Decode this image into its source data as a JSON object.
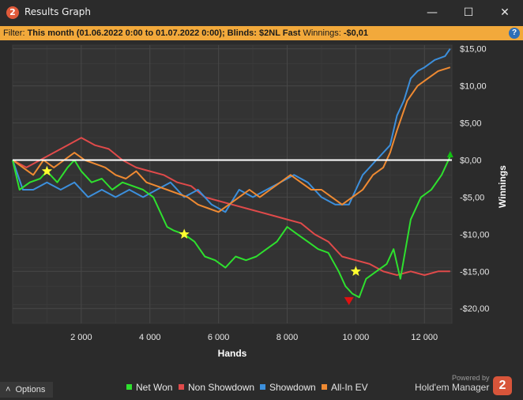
{
  "window": {
    "title": "Results Graph",
    "logo_glyph": "2",
    "minimize_glyph": "—",
    "maximize_glyph": "☐",
    "close_glyph": "✕"
  },
  "filter": {
    "label": "Filter:",
    "value": "This month (01.06.2022 0:00 to 01.07.2022 0:00); Blinds: $2NL Fast",
    "winnings_label": "Winnings:",
    "winnings_value": "-$0,01",
    "help_glyph": "?"
  },
  "footer": {
    "options_label": "Options",
    "options_glyph": "˄",
    "powered_by": "Powered by",
    "brand": "Hold'em Manager",
    "brand_logo": "2"
  },
  "colors": {
    "net_won": "#2ee02e",
    "non_showdown": "#e04a4a",
    "showdown": "#3c8fdc",
    "allin_ev": "#ef8a32",
    "zero_line": "#ffffff",
    "filter_bar": "#f2a93b"
  },
  "chart_data": {
    "type": "line",
    "xlabel": "Hands",
    "ylabel": "Winnings",
    "xlim": [
      0,
      12800
    ],
    "ylim": [
      -22,
      15.5
    ],
    "x_ticks": [
      2000,
      4000,
      6000,
      8000,
      10000,
      12000
    ],
    "x_tick_labels": [
      "2 000",
      "4 000",
      "6 000",
      "8 000",
      "10 000",
      "12 000"
    ],
    "y_ticks": [
      15,
      10,
      5,
      0,
      -5,
      -10,
      -15,
      -20
    ],
    "y_tick_labels": [
      "$15,00",
      "$10,00",
      "$5,00",
      "$0,00",
      "-$5,00",
      "-$10,00",
      "-$15,00",
      "-$20,00"
    ],
    "grid": true,
    "legend_position": "bottom-center",
    "series": [
      {
        "name": "Net Won",
        "color": "#2ee02e",
        "x": [
          0,
          200,
          500,
          800,
          1000,
          1300,
          1600,
          1800,
          2000,
          2300,
          2600,
          2900,
          3200,
          3500,
          3800,
          4100,
          4300,
          4500,
          4700,
          5000,
          5300,
          5600,
          5900,
          6200,
          6500,
          6800,
          7100,
          7400,
          7700,
          8000,
          8300,
          8600,
          8900,
          9200,
          9500,
          9700,
          9900,
          10100,
          10300,
          10600,
          10900,
          11100,
          11300,
          11600,
          11900,
          12200,
          12500,
          12750
        ],
        "y": [
          0,
          -4,
          -3,
          -2.5,
          -1.5,
          -3,
          -1,
          0,
          -1.5,
          -3,
          -2.5,
          -4,
          -3,
          -3.5,
          -4,
          -5,
          -7,
          -9,
          -9.5,
          -10,
          -11,
          -13,
          -13.5,
          -14.5,
          -13,
          -13.5,
          -13,
          -12,
          -11,
          -9,
          -10,
          -11,
          -12,
          -12.5,
          -15,
          -17,
          -18,
          -18.5,
          -16,
          -15,
          -14,
          -12,
          -16,
          -8,
          -5,
          -4,
          -2,
          0.5
        ]
      },
      {
        "name": "Non Showdown",
        "color": "#e04a4a",
        "x": [
          0,
          400,
          800,
          1200,
          1600,
          2000,
          2400,
          2800,
          3200,
          3600,
          4000,
          4400,
          4800,
          5200,
          5600,
          6000,
          6400,
          6800,
          7200,
          7600,
          8000,
          8400,
          8800,
          9200,
          9600,
          10000,
          10400,
          10800,
          11200,
          11600,
          12000,
          12400,
          12750
        ],
        "y": [
          0,
          -1,
          0,
          1,
          2,
          3,
          2,
          1.5,
          0,
          -1,
          -1.5,
          -2,
          -3,
          -3.5,
          -5,
          -5.5,
          -6,
          -6.5,
          -7,
          -7.5,
          -8,
          -8.5,
          -10,
          -11,
          -13,
          -13.5,
          -14,
          -15,
          -15.5,
          -15,
          -15.5,
          -15,
          -15
        ]
      },
      {
        "name": "Showdown",
        "color": "#3c8fdc",
        "x": [
          0,
          300,
          600,
          1000,
          1400,
          1800,
          2200,
          2600,
          3000,
          3400,
          3800,
          4200,
          4600,
          5000,
          5400,
          5800,
          6200,
          6600,
          7000,
          7400,
          7800,
          8200,
          8600,
          9000,
          9400,
          9800,
          10200,
          10600,
          11000,
          11200,
          11400,
          11600,
          11800,
          12000,
          12300,
          12600,
          12750
        ],
        "y": [
          0,
          -4,
          -4,
          -3,
          -4,
          -3,
          -5,
          -4,
          -5,
          -4,
          -5,
          -4,
          -3,
          -5,
          -4,
          -6,
          -7,
          -4,
          -5,
          -4,
          -3,
          -2,
          -3,
          -5,
          -6,
          -6,
          -2,
          0,
          2,
          6,
          8,
          11,
          12,
          12.5,
          13.5,
          14,
          15
        ]
      },
      {
        "name": "All-In EV",
        "color": "#ef8a32",
        "x": [
          0,
          300,
          600,
          900,
          1200,
          1500,
          1800,
          2100,
          2400,
          2700,
          3000,
          3300,
          3600,
          3900,
          4200,
          4500,
          4800,
          5100,
          5400,
          5700,
          6000,
          6300,
          6600,
          6900,
          7200,
          7500,
          7800,
          8100,
          8400,
          8700,
          9000,
          9300,
          9600,
          9900,
          10200,
          10500,
          10800,
          11000,
          11200,
          11500,
          11800,
          12100,
          12400,
          12750
        ],
        "y": [
          0,
          -1,
          -2,
          0,
          -1,
          0,
          1,
          0,
          -0.5,
          -1,
          -2,
          -2.5,
          -1.5,
          -3,
          -3.5,
          -4,
          -4.5,
          -5,
          -6,
          -6.5,
          -7,
          -6,
          -5,
          -4,
          -5,
          -4,
          -3,
          -2,
          -3,
          -4,
          -4,
          -5,
          -6,
          -5,
          -4,
          -2,
          -1,
          1,
          4,
          8,
          10,
          11,
          12,
          12.5
        ]
      }
    ],
    "markers": [
      {
        "type": "star",
        "x": 1000,
        "y": -1.5,
        "color": "#ffff30"
      },
      {
        "type": "star",
        "x": 5000,
        "y": -10,
        "color": "#ffff30"
      },
      {
        "type": "star",
        "x": 10000,
        "y": -15,
        "color": "#ffff30"
      },
      {
        "type": "triangle-down",
        "x": 9800,
        "y": -19,
        "color": "#e01010"
      },
      {
        "type": "triangle-up",
        "x": 12750,
        "y": 0.8,
        "color": "#10c010"
      }
    ]
  }
}
